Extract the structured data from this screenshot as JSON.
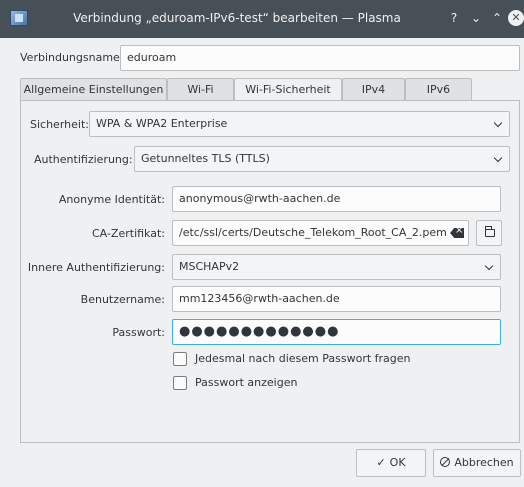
{
  "window": {
    "title": "Verbindung „eduroam-IPv6-test“ bearbeiten — Plasma",
    "help_glyph": "?",
    "minimize_glyph": "⌄",
    "maximize_glyph": "⌃",
    "close_glyph": "✕"
  },
  "connection": {
    "name_label": "Verbindungsname:",
    "name_value": "eduroam"
  },
  "tabs": [
    {
      "label": "Allgemeine Einstellungen"
    },
    {
      "label": "Wi-Fi"
    },
    {
      "label": "Wi-Fi-Sicherheit",
      "active": true
    },
    {
      "label": "IPv4"
    },
    {
      "label": "IPv6"
    }
  ],
  "security": {
    "label": "Sicherheit:",
    "value": "WPA & WPA2 Enterprise"
  },
  "auth": {
    "label": "Authentifizierung:",
    "value": "Getunneltes TLS (TTLS)"
  },
  "form": {
    "anon_label": "Anonyme Identität:",
    "anon_value": "anonymous@rwth-aachen.de",
    "ca_label": "CA-Zertifikat:",
    "ca_value": "/etc/ssl/certs/Deutsche_Telekom_Root_CA_2.pem",
    "inner_label": "Innere Authentifizierung:",
    "inner_value": "MSCHAPv2",
    "user_label": "Benutzername:",
    "user_value": "mm123456@rwth-aachen.de",
    "pass_label": "Passwort:",
    "pass_value": "●●●●●●●●●●●●●",
    "ask_label": "Jedesmal nach diesem Passwort fragen",
    "show_label": "Passwort anzeigen"
  },
  "buttons": {
    "ok_label": "OK",
    "cancel_label": "Abbrechen"
  }
}
